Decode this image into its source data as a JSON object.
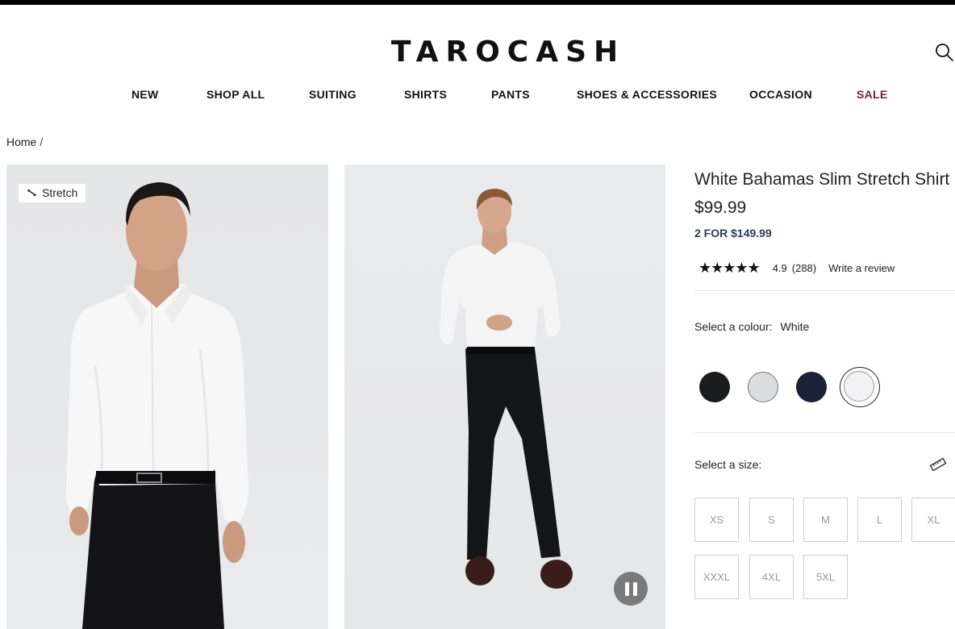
{
  "brand": {
    "logo_text": "TAROCASH"
  },
  "nav": {
    "items": [
      "NEW",
      "SHOP ALL",
      "SUITING",
      "SHIRTS",
      "PANTS",
      "SHOES & ACCESSORIES",
      "OCCASION",
      "SALE"
    ],
    "sale_color": "#7a1f2b"
  },
  "breadcrumb": {
    "home": "Home",
    "separator": "/"
  },
  "gallery": {
    "badge_label": "Stretch",
    "video_control_icon": "pause-icon"
  },
  "product": {
    "title": "White Bahamas Slim Stretch Shirt",
    "price": "$99.99",
    "promo": "2 FOR $149.99",
    "rating": {
      "stars": 5,
      "value": "4.9",
      "count": "(288)",
      "write_review": "Write a review"
    },
    "colour": {
      "label": "Select a colour:",
      "selected": "White",
      "swatches": [
        {
          "color": "#1b1c1f"
        },
        {
          "color": "#dcdde1"
        },
        {
          "color": "#1a2138"
        },
        {
          "color": "#f2f2f4"
        }
      ]
    },
    "size": {
      "label": "Select a size:",
      "options": [
        "XS",
        "S",
        "M",
        "L",
        "XL",
        "XXXL",
        "4XL",
        "5XL"
      ]
    }
  },
  "colors": {
    "promo_blue": "#2a3d5c",
    "text": "#222222"
  }
}
